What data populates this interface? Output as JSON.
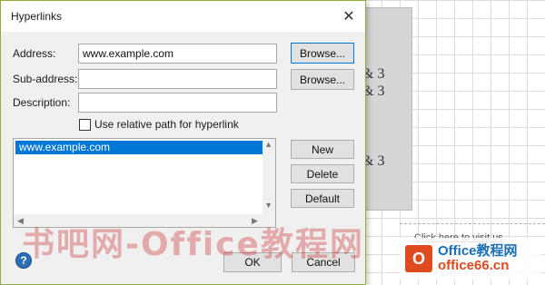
{
  "background": {
    "shape_text": [
      "& 3",
      "& 3",
      "& 3"
    ],
    "visit_link": "Click here to visit us",
    "watermark": "书吧网-Office教程网",
    "brand_line1": "Office教程网",
    "brand_line2": "office66.cn"
  },
  "dialog": {
    "title": "Hyperlinks",
    "close_glyph": "✕",
    "address_label": "Address:",
    "address_value": "www.example.com",
    "subaddress_label": "Sub-address:",
    "subaddress_value": "",
    "description_label": "Description:",
    "description_value": "",
    "browse_label": "Browse...",
    "relative_path_label": "Use relative path for hyperlink",
    "relative_path_checked": false,
    "links": [
      "www.example.com"
    ],
    "new_label": "New",
    "delete_label": "Delete",
    "default_label": "Default",
    "help_glyph": "?",
    "ok_label": "OK",
    "cancel_label": "Cancel"
  },
  "colors": {
    "selection": "#0078d7",
    "dialog_border": "#8fae3c",
    "help_icon": "#2d6fb5"
  }
}
